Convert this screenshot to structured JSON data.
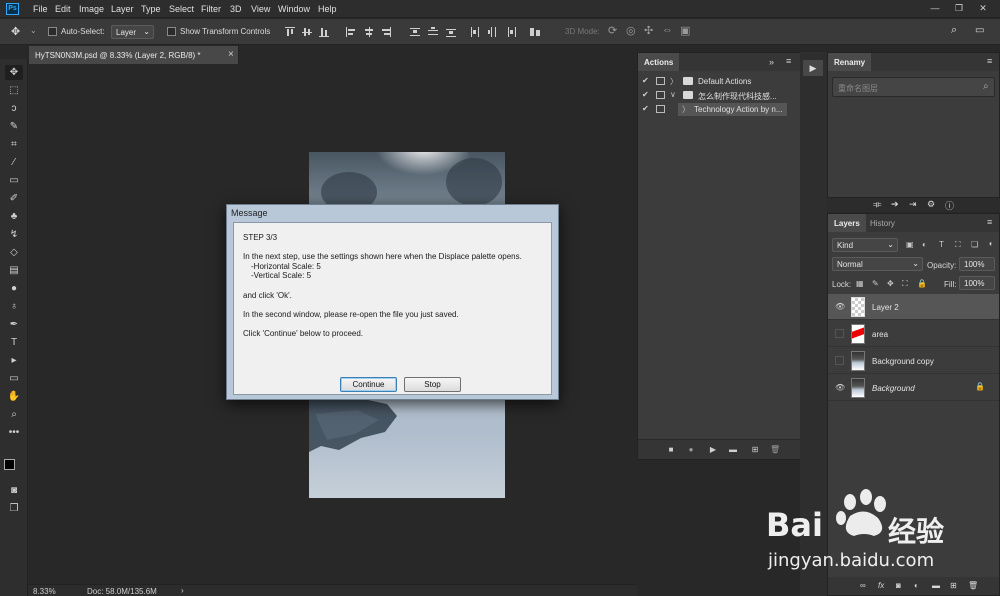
{
  "menu": {
    "logo": "Ps",
    "items": [
      "File",
      "Edit",
      "Image",
      "Layer",
      "Type",
      "Select",
      "Filter",
      "3D",
      "View",
      "Window",
      "Help"
    ],
    "window_controls": [
      "—",
      "❐",
      "✕"
    ]
  },
  "options_bar": {
    "auto_select_label": "Auto-Select:",
    "auto_select_value": "Layer",
    "show_transform_label": "Show Transform Controls",
    "three_d_mode_label": "3D Mode:"
  },
  "document": {
    "tab_title": "HyTSN0N3M.psd @ 8.33% (Layer 2, RGB/8) *",
    "tab_close": "×",
    "zoom": "8.33%",
    "doc_size": "Doc: 58.0M/135.6M"
  },
  "actions_panel": {
    "tab_label": "Actions",
    "rows": [
      {
        "check": "✔",
        "twirl": "〉",
        "label": "Default Actions"
      },
      {
        "check": "✔",
        "twirl": "∨",
        "label": "怎么制作现代科技感..."
      },
      {
        "check": "✔",
        "twirl": "〉",
        "label": "Technology Action by n..."
      }
    ]
  },
  "rename_panel": {
    "tab_label": "Renamy",
    "input_placeholder": "重命名图层"
  },
  "layers_panel": {
    "tabs": [
      "Layers",
      "History"
    ],
    "filter_kind": "Kind",
    "blend_mode": "Normal",
    "opacity_label": "Opacity:",
    "opacity_value": "100%",
    "lock_label": "Lock:",
    "fill_label": "Fill:",
    "fill_value": "100%",
    "layers": [
      {
        "name": "Layer 2",
        "visible": true,
        "selected": true
      },
      {
        "name": "area",
        "visible": false
      },
      {
        "name": "Background copy",
        "visible": false
      },
      {
        "name": "Background",
        "visible": true,
        "locked": true
      }
    ]
  },
  "dialog": {
    "title": "Message",
    "step": "STEP 3/3",
    "line1": "In the next step, use the settings shown here when the Displace palette opens.",
    "line2": "-Horizontal Scale: 5",
    "line3": "-Vertical Scale: 5",
    "line4": "and click 'Ok'.",
    "line5": "In the second window, please re-open the file you just saved.",
    "line6": "Click 'Continue' below to proceed.",
    "continue_label": "Continue",
    "stop_label": "Stop"
  },
  "watermark": {
    "brand": "Bai",
    "brand2": "经验",
    "url": "jingyan.baidu.com"
  },
  "colors": {
    "accent": "#31a8ff",
    "panel": "#3c3c3c",
    "dialog_frame": "#b9c8d8"
  }
}
